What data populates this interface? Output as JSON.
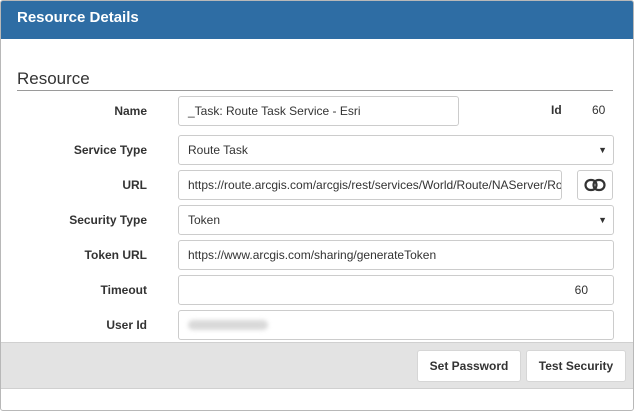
{
  "dialog": {
    "title": "Resource Details",
    "section_title": "Resource"
  },
  "form": {
    "name": {
      "label": "Name",
      "value": "_Task: Route Task Service - Esri"
    },
    "id": {
      "label": "Id",
      "value": "60"
    },
    "service_type": {
      "label": "Service Type",
      "value": "Route Task"
    },
    "url": {
      "label": "URL",
      "value": "https://route.arcgis.com/arcgis/rest/services/World/Route/NAServer/Route_World"
    },
    "security_type": {
      "label": "Security Type",
      "value": "Token"
    },
    "token_url": {
      "label": "Token URL",
      "value": "https://www.arcgis.com/sharing/generateToken"
    },
    "timeout": {
      "label": "Timeout",
      "value": "60"
    },
    "user_id": {
      "label": "User Id"
    }
  },
  "footer": {
    "set_password_label": "Set Password",
    "test_security_label": "Test Security"
  },
  "icons": {
    "caret": "caret-down-icon",
    "link": "link-icon"
  },
  "colors": {
    "titlebar": "#2e6da4",
    "footer": "#e3e3e3"
  }
}
